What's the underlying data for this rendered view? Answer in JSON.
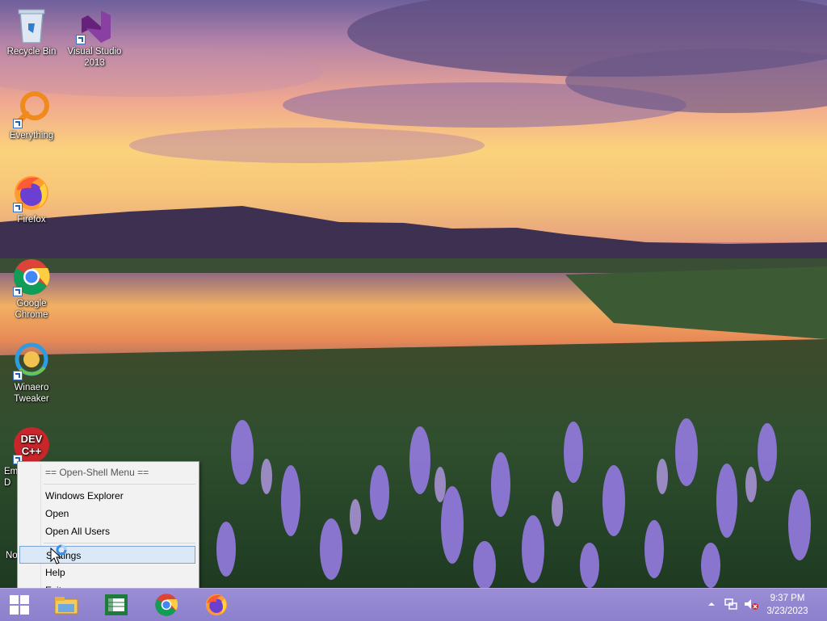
{
  "desktop": {
    "icons": [
      {
        "label": "Recycle Bin",
        "icon": "recycle-bin-icon"
      },
      {
        "label": "Visual Studio 2013",
        "icon": "visual-studio-icon"
      },
      {
        "label": "Everything",
        "icon": "everything-search-icon"
      },
      {
        "label": "Firefox",
        "icon": "firefox-icon"
      },
      {
        "label": "Google Chrome",
        "icon": "chrome-icon"
      },
      {
        "label": "Winaero Tweaker",
        "icon": "winaero-tweaker-icon"
      },
      {
        "label": "Em\nD",
        "icon": "dev-cpp-icon"
      },
      {
        "label": "No",
        "icon": "notepad-icon"
      }
    ],
    "dev_badge": "DEV\nC++"
  },
  "context_menu": {
    "title": "== Open-Shell Menu ==",
    "items": [
      {
        "label": "Windows Explorer"
      },
      {
        "label": "Open"
      },
      {
        "label": "Open All Users"
      },
      {
        "label": "Settings",
        "highlighted": true
      },
      {
        "label": "Help"
      },
      {
        "label": "Exit",
        "mark": "x"
      }
    ]
  },
  "taskbar": {
    "start_icon": "windows-start-icon",
    "pinned": [
      "file-explorer-icon",
      "excel-icon",
      "chrome-icon",
      "firefox-icon"
    ],
    "tray": {
      "show_hidden_icon": "chevron-up-icon",
      "network_icon": "network-icon",
      "volume_icon": "volume-muted-icon",
      "time": "9:37 PM",
      "date": "3/23/2023"
    }
  },
  "colors": {
    "taskbar": "#8c7fcc",
    "menu_bg": "#f2f2f2",
    "menu_highlight": "#dbe8f8",
    "menu_highlight_border": "#7aa4d8"
  }
}
